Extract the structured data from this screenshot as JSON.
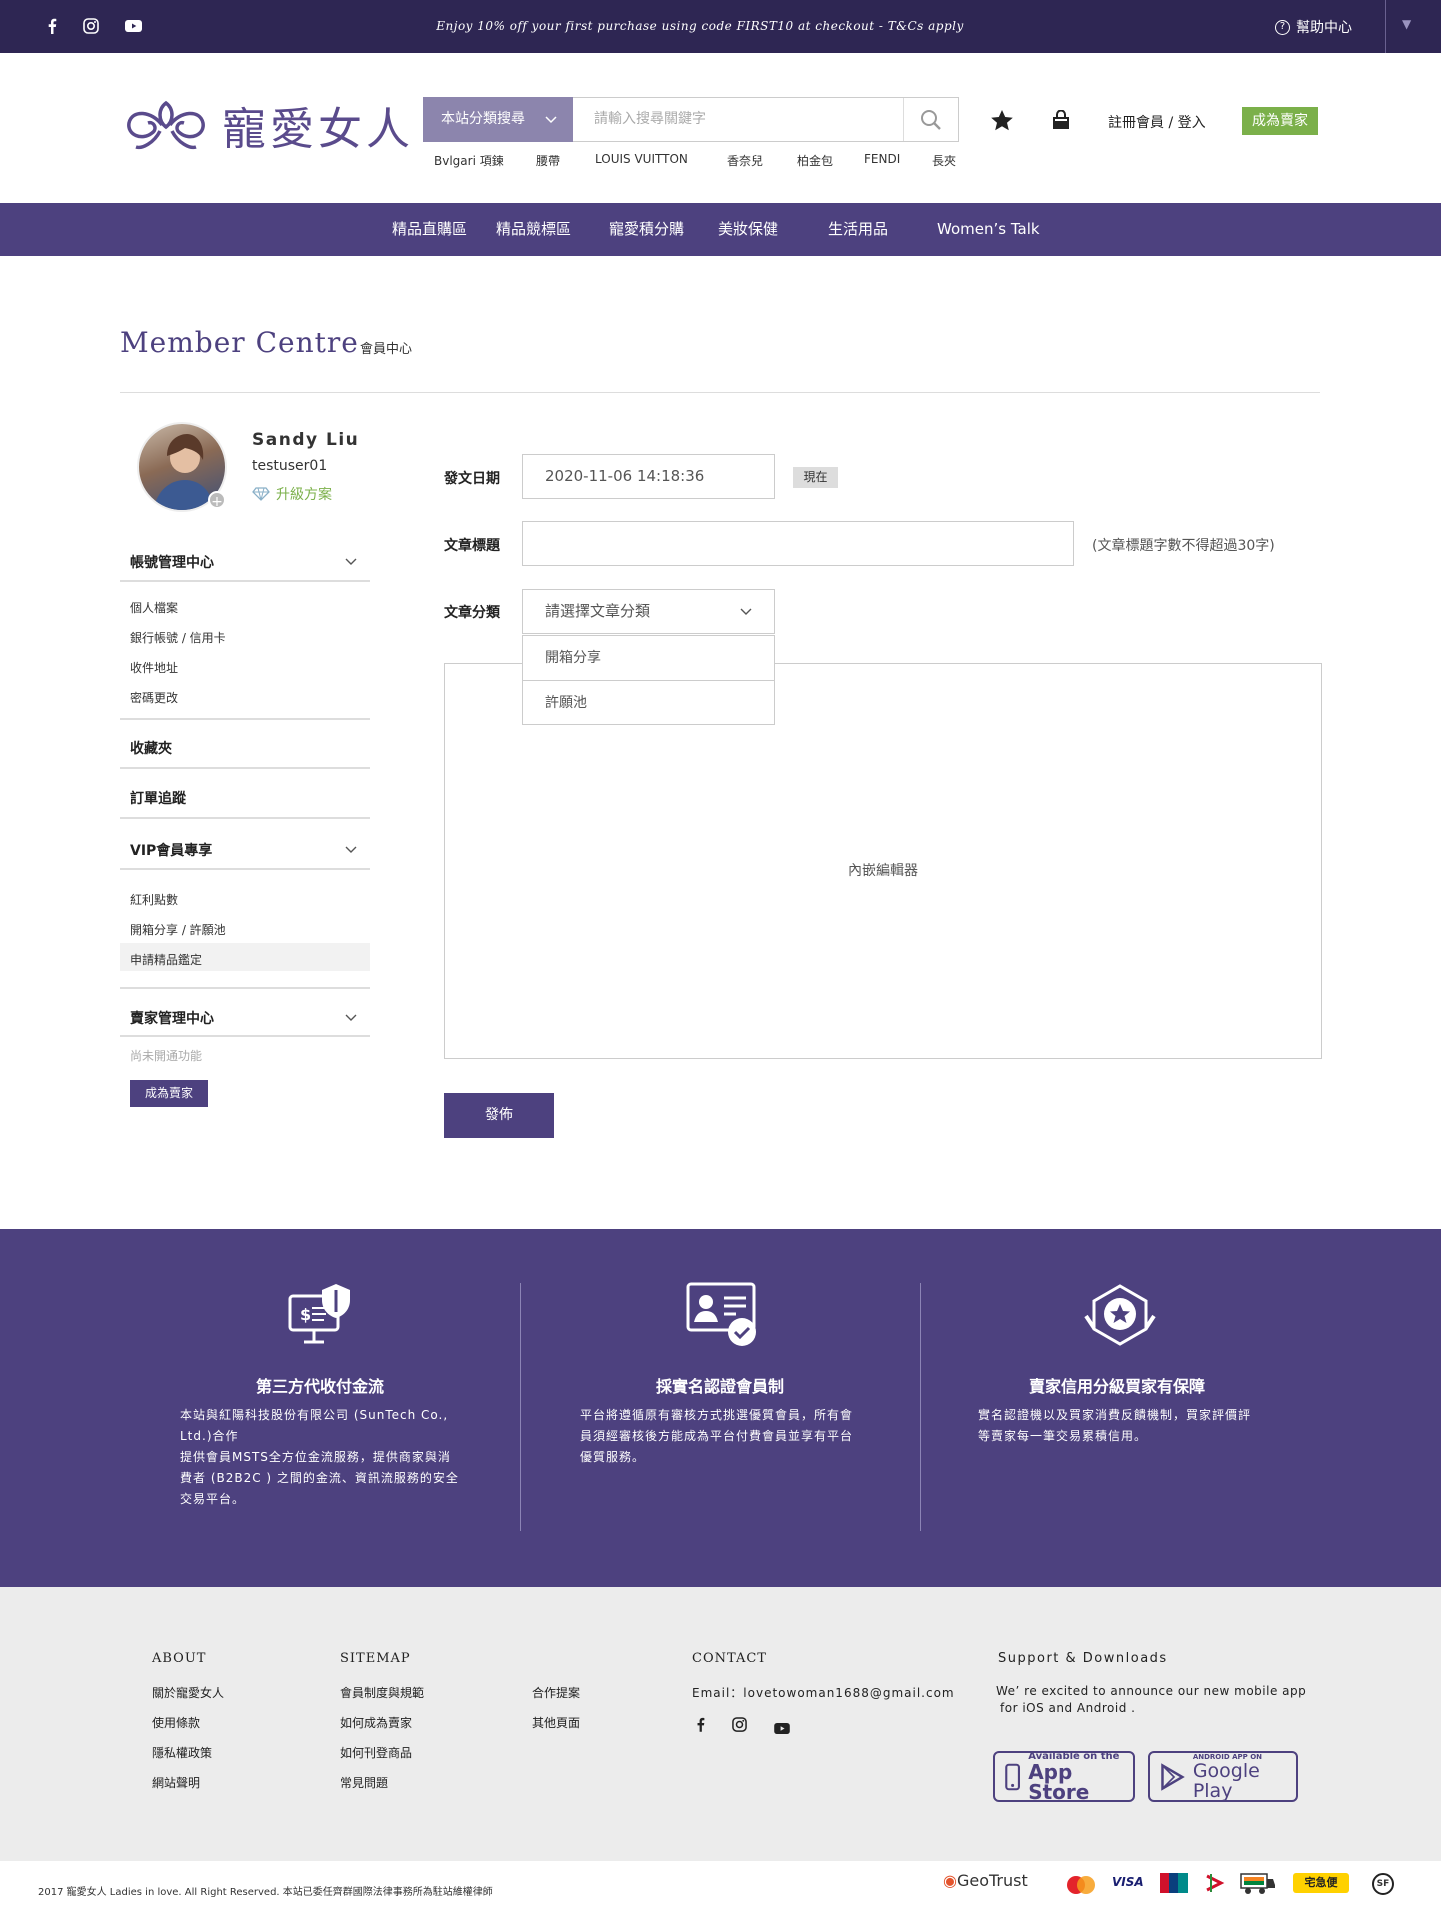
{
  "topbar": {
    "promo": "Enjoy 10% off your first purchase using code FIRST10 at checkout - T&Cs apply",
    "help": "幫助中心",
    "lang_arrow": "▼"
  },
  "header": {
    "logo_text": "寵愛女人",
    "search_category": "本站分類搜尋",
    "search_placeholder": "請輸入搜尋關鍵字",
    "hot_keywords": [
      "Bvlgari 項鍊",
      "腰帶",
      "LOUIS VUITTON",
      "香奈兒",
      "柏金包",
      "FENDI",
      "長夾"
    ],
    "login": "註冊會員 / 登入",
    "become_seller": "成為賣家"
  },
  "nav": [
    "精品直購區",
    "精品競標區",
    "寵愛積分購",
    "美妝保健",
    "生活用品",
    "Women’s Talk"
  ],
  "page": {
    "title_en": "Member Centre",
    "title_zh": "會員中心"
  },
  "profile": {
    "name": "Sandy Liu",
    "username": "testuser01",
    "plan": "升級方案"
  },
  "sidebar": {
    "account": "帳號管理中心",
    "account_items": [
      "個人檔案",
      "銀行帳號 / 信用卡",
      "收件地址",
      "密碼更改"
    ],
    "favorites": "收藏夾",
    "orders": "訂單追蹤",
    "vip": "VIP會員專享",
    "vip_items": [
      "紅利點數",
      "開箱分享 / 許願池",
      "申請精品鑑定"
    ],
    "seller": "賣家管理中心",
    "seller_note": "尚未開通功能",
    "seller_button": "成為賣家"
  },
  "form": {
    "date_label": "發文日期",
    "date_value": "2020-11-06  14:18:36",
    "now_badge": "現在",
    "title_label": "文章標題",
    "title_hint": "(文章標題字數不得超過30字)",
    "category_label": "文章分類",
    "category_placeholder": "請選擇文章分類",
    "category_options": [
      "開箱分享",
      "許願池"
    ],
    "editor_label": "內嵌編輯器",
    "publish": "發佈"
  },
  "features": [
    {
      "title": "第三方代收付金流",
      "body": [
        "本站與紅陽科技股份有限公司 (SunTech Co.,",
        "Ltd.)合作",
        "提供會員MSTS全方位金流服務，提供商家與消",
        "費者 (B2B2C ) 之間的金流、資訊流服務的安全",
        "交易平台。"
      ]
    },
    {
      "title": "採實名認證會員制",
      "body": [
        "平台將遵循原有審核方式挑選優質會員，所有會",
        "員須經審核後方能成為平台付費會員並享有平台",
        "優質服務。"
      ]
    },
    {
      "title": "賣家信用分級買家有保障",
      "body": [
        "實名認證機以及買家消費反饋機制，買家評價評",
        "等賣家每一筆交易累積信用。"
      ]
    }
  ],
  "footer": {
    "about_title": "ABOUT",
    "about_links": [
      "關於寵愛女人",
      "使用條款",
      "隱私權政策",
      "網站聲明"
    ],
    "sitemap_title": "SITEMAP",
    "sitemap_links": [
      "會員制度與規範",
      "如何成為賣家",
      "如何刊登商品",
      "常見問題"
    ],
    "sitemap_links2": [
      "合作提案",
      "其他頁面"
    ],
    "contact_title": "CONTACT",
    "email": "Email：lovetowoman1688@gmail.com",
    "support_title": "Support & Downloads",
    "support_text_1": "We’ re excited to announce our new mobile app",
    "support_text_2": "for iOS and Android .",
    "appstore_small": "Available on the",
    "appstore_big": "App Store",
    "googleplay_small": "ANDROID APP ON",
    "googleplay_big": "Google Play",
    "copyright": "2017 寵愛女人 Ladies in love. All Right Reserved.    本站已委任齊群國際法律事務所為駐站維權律師",
    "payment_logos": [
      "GeoTrust",
      "MasterCard",
      "VISA",
      "UnionPay",
      "郵局",
      "7-ELEVEN",
      "宅急便",
      "SF EXPRESS"
    ]
  },
  "colors": {
    "primary": "#4d417f",
    "topbar": "#2e2653",
    "accent_green": "#7bb04a",
    "footer_bg": "#ececec"
  }
}
